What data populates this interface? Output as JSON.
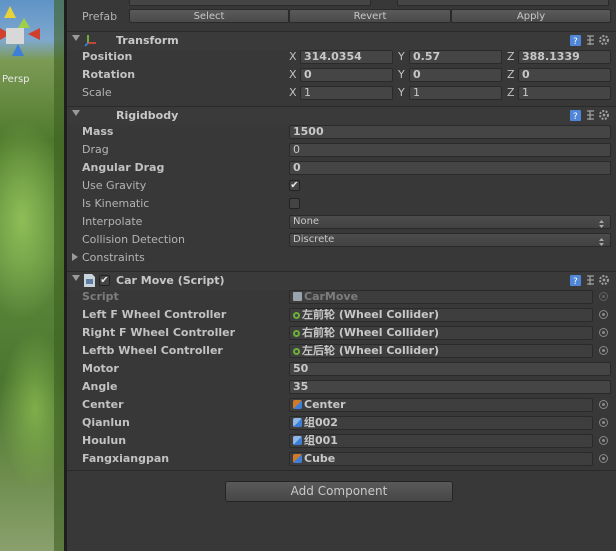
{
  "scene_view": {
    "persp_label": "Persp"
  },
  "prefab": {
    "label": "Prefab",
    "select": "Select",
    "revert": "Revert",
    "apply": "Apply"
  },
  "transform": {
    "title": "Transform",
    "position": {
      "label": "Position",
      "x": "314.0354",
      "y": "0.57",
      "z": "388.1339"
    },
    "rotation": {
      "label": "Rotation",
      "x": "0",
      "y": "0",
      "z": "0"
    },
    "scale": {
      "label": "Scale",
      "x": "1",
      "y": "1",
      "z": "1"
    }
  },
  "axes": {
    "x": "X",
    "y": "Y",
    "z": "Z"
  },
  "rigidbody": {
    "title": "Rigidbody",
    "mass": {
      "label": "Mass",
      "value": "1500"
    },
    "drag": {
      "label": "Drag",
      "value": "0"
    },
    "angular_drag": {
      "label": "Angular Drag",
      "value": "0"
    },
    "use_gravity": {
      "label": "Use Gravity",
      "checked": true
    },
    "is_kinematic": {
      "label": "Is Kinematic",
      "checked": false
    },
    "interpolate": {
      "label": "Interpolate",
      "value": "None"
    },
    "collision_detection": {
      "label": "Collision Detection",
      "value": "Discrete"
    },
    "constraints": {
      "label": "Constraints"
    }
  },
  "carmove": {
    "title": "Car Move (Script)",
    "script": {
      "label": "Script",
      "value": "CarMove"
    },
    "left_f": {
      "label": "Left F Wheel Controller",
      "value": "左前轮 (Wheel Collider)"
    },
    "right_f": {
      "label": "Right F Wheel Controller",
      "value": "右前轮 (Wheel Collider)"
    },
    "leftb": {
      "label": "Leftb Wheel Controller",
      "value": "左后轮 (Wheel Collider)"
    },
    "motor": {
      "label": "Motor",
      "value": "50"
    },
    "angle": {
      "label": "Angle",
      "value": "35"
    },
    "center": {
      "label": "Center",
      "value": "Center"
    },
    "qianlun": {
      "label": "Qianlun",
      "value": "组002"
    },
    "houlun": {
      "label": "Houlun",
      "value": "组001"
    },
    "fangxiangpan": {
      "label": "Fangxiangpan",
      "value": "Cube"
    }
  },
  "add_component": "Add Component",
  "colors": {
    "panel_bg": "#383838",
    "field_bg": "#454545",
    "wheel_icon": "#6db03a"
  }
}
